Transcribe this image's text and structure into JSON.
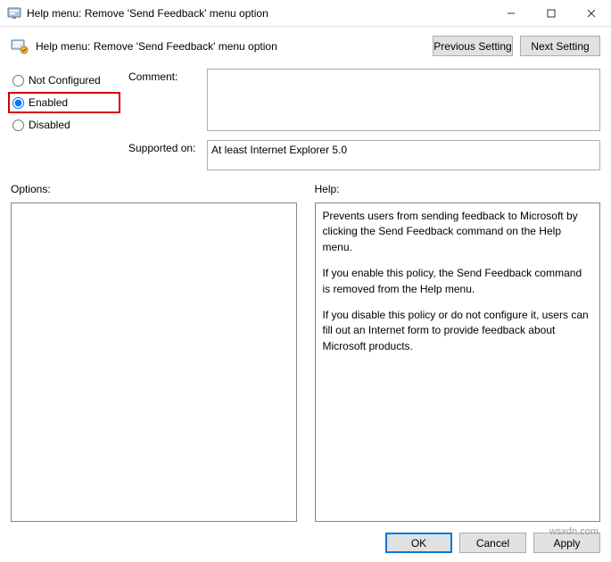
{
  "window": {
    "title": "Help menu: Remove 'Send Feedback' menu option",
    "minimize": "—",
    "maximize": "▢",
    "close": "✕"
  },
  "header": {
    "policy_title": "Help menu: Remove 'Send Feedback' menu option",
    "previous_label": "Previous Setting",
    "next_label": "Next Setting"
  },
  "settings": {
    "not_configured_label": "Not Configured",
    "enabled_label": "Enabled",
    "disabled_label": "Disabled",
    "selected": "enabled"
  },
  "fields": {
    "comment_label": "Comment:",
    "comment_value": "",
    "supported_label": "Supported on:",
    "supported_value": "At least Internet Explorer 5.0"
  },
  "lower": {
    "options_label": "Options:",
    "help_label": "Help:",
    "help_text_1": "Prevents users from sending feedback to Microsoft by clicking the Send Feedback command on the Help menu.",
    "help_text_2": "If you enable this policy, the Send Feedback command is removed from the Help menu.",
    "help_text_3": "If you disable this policy or do not configure it, users can fill out an Internet form to provide feedback about Microsoft products."
  },
  "footer": {
    "ok_label": "OK",
    "cancel_label": "Cancel",
    "apply_label": "Apply"
  },
  "watermark": "wsxdn.com"
}
